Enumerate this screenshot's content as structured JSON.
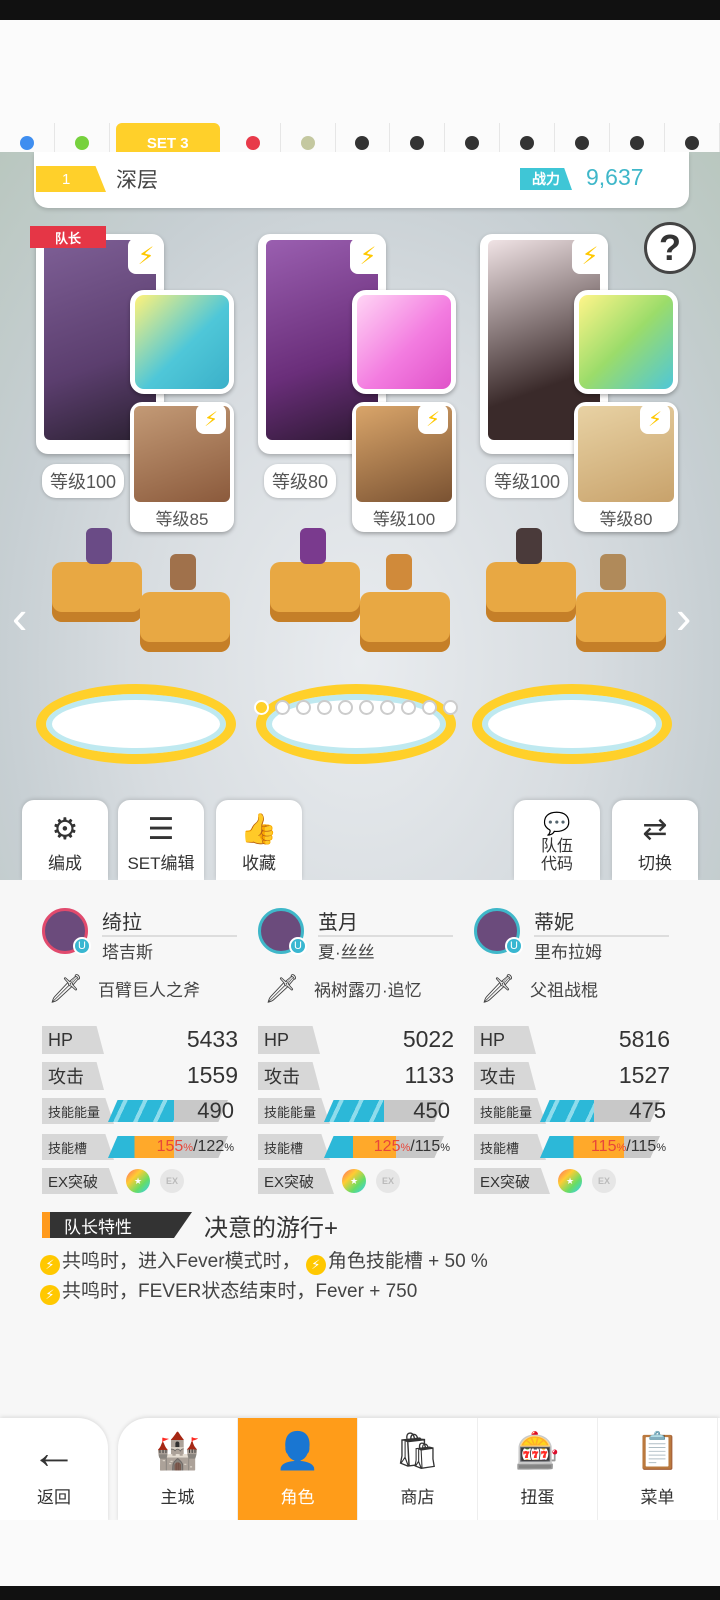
{
  "set_tabs": [
    {
      "type": "dot",
      "color": "#3f8ef0"
    },
    {
      "type": "dot",
      "color": "#76d13d"
    },
    {
      "type": "label",
      "label": "SET 3"
    },
    {
      "type": "dot",
      "color": "#e83a4a"
    },
    {
      "type": "dot",
      "color": "#c4c8a0"
    },
    {
      "type": "dot",
      "color": "#333333"
    },
    {
      "type": "dot",
      "color": "#333333"
    },
    {
      "type": "dot",
      "color": "#333333"
    },
    {
      "type": "dot",
      "color": "#333333"
    },
    {
      "type": "dot",
      "color": "#333333"
    },
    {
      "type": "dot",
      "color": "#333333"
    },
    {
      "type": "dot",
      "color": "#333333"
    }
  ],
  "team": {
    "number": "1",
    "name": "深层",
    "power_label": "战力",
    "power_value": "9,637"
  },
  "help_icon": "?",
  "leader_tag": "队长",
  "characters": [
    {
      "level": "等级100",
      "support_level": "等级85",
      "weapon_color": "#4fc7d8",
      "portrait_color": "#5b3e6e",
      "support_color": "#8b5a3c"
    },
    {
      "level": "等级80",
      "support_level": "等级100",
      "weapon_color": "#f37ce0",
      "portrait_color": "#6a2e7a",
      "support_color": "#7a5232"
    },
    {
      "level": "等级100",
      "support_level": "等级80",
      "weapon_color": "#9bdc6a",
      "portrait_color": "#3a2a2a",
      "support_color": "#c8a26b"
    }
  ],
  "page_dots": 10,
  "page_active": 0,
  "toolbar": {
    "edit": "编成",
    "set_edit": "SET编辑",
    "favorite": "收藏",
    "team_code": "队伍\n代码",
    "switch": "切换"
  },
  "stats": [
    {
      "name": "绮拉",
      "support": "塔吉斯",
      "weapon": "百臂巨人之斧",
      "hp": "5433",
      "atk": "1559",
      "energy": "490",
      "slot_a": "155",
      "slot_b": "122",
      "energy_fill": 0.55,
      "slot_fill": 0.55,
      "avatar_border": "#e14a6d"
    },
    {
      "name": "茧月",
      "support": "夏·丝丝",
      "weapon": "祸树露刃·追忆",
      "hp": "5022",
      "atk": "1133",
      "energy": "450",
      "slot_a": "125",
      "slot_b": "115",
      "energy_fill": 0.5,
      "slot_fill": 0.6,
      "avatar_border": "#3fb7c9"
    },
    {
      "name": "蒂妮",
      "support": "里布拉姆",
      "weapon": "父祖战棍",
      "hp": "5816",
      "atk": "1527",
      "energy": "475",
      "slot_a": "115",
      "slot_b": "115",
      "energy_fill": 0.45,
      "slot_fill": 0.7,
      "avatar_border": "#3fb7c9"
    }
  ],
  "labels": {
    "hp": "HP",
    "atk": "攻击",
    "energy": "技能能量",
    "slot": "技能槽",
    "ex": "EX突破",
    "pct": "%"
  },
  "leader_trait": {
    "label": "队长特性",
    "title": "决意的游行+",
    "lines": [
      {
        "a": "共鸣时，进入Fever模式时，",
        "b": "角色技能槽 + 50 %"
      },
      {
        "a": "共鸣时，FEVER状态结束时，Fever + 750",
        "b": ""
      }
    ]
  },
  "nav": {
    "back": "返回",
    "items": [
      "主城",
      "角色",
      "商店",
      "扭蛋",
      "菜单"
    ],
    "active": 1
  },
  "colors": {
    "accent": "#ffd02a",
    "orange": "#ff9c19",
    "cyan": "#3fc6d6"
  }
}
